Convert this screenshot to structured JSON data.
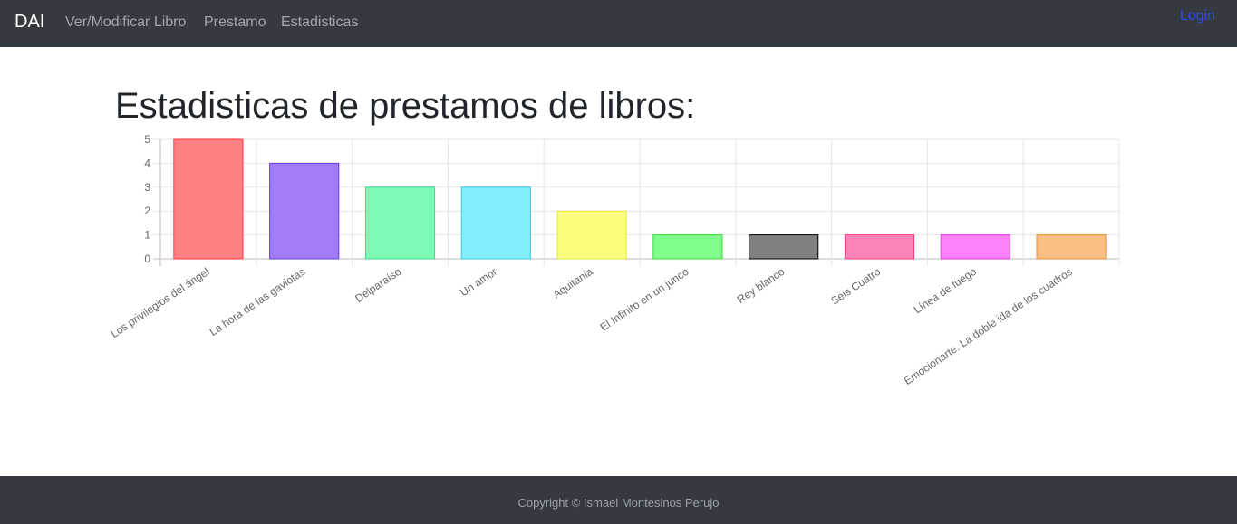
{
  "navbar": {
    "brand": "DAI",
    "links": [
      "Ver/Modificar Libro",
      "Prestamo",
      "Estadisticas"
    ],
    "login": "Login"
  },
  "main": {
    "title": "Estadisticas de prestamos de libros:"
  },
  "chart_data": {
    "type": "bar",
    "categories": [
      "Los privilegios del ángel",
      "La hora de las gaviotas",
      "Delparaíso",
      "Un amor",
      "Aquitania",
      "El Infinito en un junco",
      "Rey blanco",
      "Seis Cuatro",
      "Línea de fuego",
      "Emocionarte. La doble ida de los cuadros"
    ],
    "values": [
      5,
      4,
      3,
      3,
      2,
      1,
      1,
      1,
      1,
      1
    ],
    "colors": [
      {
        "fill": "#ff8080",
        "stroke": "#ff3344"
      },
      {
        "fill": "#a07cf8",
        "stroke": "#6a3ad8"
      },
      {
        "fill": "#7dfab6",
        "stroke": "#3ad890"
      },
      {
        "fill": "#80effb",
        "stroke": "#3ac8e6"
      },
      {
        "fill": "#f9fd7e",
        "stroke": "#e6e63a"
      },
      {
        "fill": "#80fd8a",
        "stroke": "#3ad83a"
      },
      {
        "fill": "#808080",
        "stroke": "#000000"
      },
      {
        "fill": "#fd84b8",
        "stroke": "#e63a7e"
      },
      {
        "fill": "#fd80fb",
        "stroke": "#e63ae0"
      },
      {
        "fill": "#fbbf84",
        "stroke": "#e6903a"
      }
    ],
    "yticks": [
      "0",
      "1",
      "2",
      "3",
      "4",
      "5"
    ],
    "ylim": [
      0,
      5
    ],
    "grid": true,
    "legend": "none"
  },
  "footer": {
    "copyright": "Copyright © Ismael Montesinos Perujo"
  }
}
